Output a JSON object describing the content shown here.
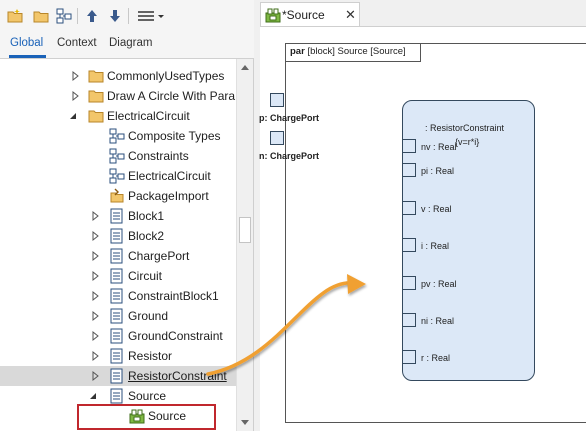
{
  "browser": {
    "tabs": [
      {
        "label": "Global"
      },
      {
        "label": "Context"
      },
      {
        "label": "Diagram"
      }
    ],
    "tree": [
      {
        "label": "CommonlyUsedTypes",
        "icon": "folder-icon",
        "arrow": "collapsed"
      },
      {
        "label": "Draw A Circle With Para",
        "icon": "folder-icon",
        "arrow": "collapsed"
      },
      {
        "label": "ElectricalCircuit",
        "icon": "folder-icon",
        "arrow": "expanded"
      },
      {
        "label": "Composite Types",
        "icon": "diagram-icon",
        "arrow": "none"
      },
      {
        "label": "Constraints",
        "icon": "diagram-icon",
        "arrow": "none"
      },
      {
        "label": "ElectricalCircuit",
        "icon": "diagram-icon",
        "arrow": "none"
      },
      {
        "label": "PackageImport",
        "icon": "package-import-icon",
        "arrow": "none"
      },
      {
        "label": "Block1",
        "icon": "block-icon",
        "arrow": "collapsed"
      },
      {
        "label": "Block2",
        "icon": "block-icon",
        "arrow": "collapsed"
      },
      {
        "label": "ChargePort",
        "icon": "block-icon",
        "arrow": "collapsed"
      },
      {
        "label": "Circuit",
        "icon": "block-icon",
        "arrow": "collapsed"
      },
      {
        "label": "ConstraintBlock1",
        "icon": "block-icon",
        "arrow": "collapsed"
      },
      {
        "label": "Ground",
        "icon": "block-icon",
        "arrow": "collapsed"
      },
      {
        "label": "GroundConstraint",
        "icon": "block-icon",
        "arrow": "collapsed"
      },
      {
        "label": "Resistor",
        "icon": "block-icon",
        "arrow": "collapsed"
      },
      {
        "label": "ResistorConstraint",
        "icon": "block-icon",
        "arrow": "collapsed"
      },
      {
        "label": "Source",
        "icon": "block-icon",
        "arrow": "expanded"
      },
      {
        "label": "Source",
        "icon": "parametric-diagram-icon",
        "arrow": "none"
      }
    ]
  },
  "document": {
    "tab_title": "*Source",
    "close_glyph": "✕",
    "frame_kind": "par",
    "frame_title": "[block] Source [Source]",
    "ports": [
      {
        "label": "p: ChargePort"
      },
      {
        "label": "n: ChargePort"
      }
    ],
    "constraint": {
      "name": ": ResistorConstraint",
      "expression": "{v=r*i}",
      "params": [
        {
          "label": "nv : Real"
        },
        {
          "label": "pi : Real"
        },
        {
          "label": "v : Real"
        },
        {
          "label": "i : Real"
        },
        {
          "label": "pv : Real"
        },
        {
          "label": "ni : Real"
        },
        {
          "label": "r : Real"
        }
      ]
    }
  },
  "colors": {
    "accent": "#1a62b8",
    "selection": "#d9d9d9",
    "highlight_border": "#c0272d",
    "block_fill": "#dce8f7",
    "drag_arrow": "#f0a030"
  }
}
